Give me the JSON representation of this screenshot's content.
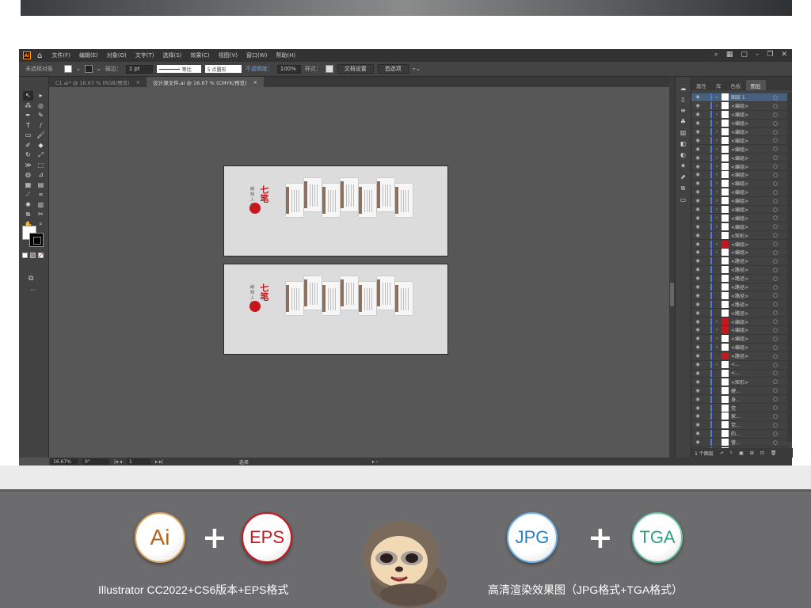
{
  "menubar": {
    "logo": "Ai",
    "items": [
      "文件(F)",
      "编辑(E)",
      "对象(O)",
      "文字(T)",
      "选择(S)",
      "效果(C)",
      "视图(V)",
      "窗口(W)",
      "帮助(H)"
    ]
  },
  "control": {
    "selection": "未选择对象",
    "stroke_label": "描边：",
    "stroke_value": "1 pt",
    "stroke_style": "等比",
    "brush": "5 点圆形",
    "opacity_label": "不透明度：",
    "opacity_value": "100%",
    "style_label": "样式：",
    "doc_setup": "文档设置",
    "preferences": "首选项"
  },
  "tabs": [
    {
      "label": "C1.ai* @ 16.67 % (RGB/预览)"
    },
    {
      "label": "设计源文件.ai @ 16.67 % (CMYK/预览)"
    }
  ],
  "close_glyph": "×",
  "artboard": {
    "title_red": "七笔",
    "title_red2": "悦",
    "subtitle": "翩翔人生"
  },
  "layers_panel": {
    "tabs": [
      "属性",
      "库",
      "色板",
      "图层"
    ],
    "layer_name": "图层 1",
    "rows": [
      {
        "label": "<编组>",
        "exp": true
      },
      {
        "label": "<编组>",
        "exp": true
      },
      {
        "label": "<编组>",
        "exp": true
      },
      {
        "label": "<编组>",
        "exp": true
      },
      {
        "label": "<编组>",
        "exp": true
      },
      {
        "label": "<编组>",
        "exp": true
      },
      {
        "label": "<编组>",
        "exp": true
      },
      {
        "label": "<编组>",
        "exp": true
      },
      {
        "label": "<编组>",
        "exp": true
      },
      {
        "label": "<编组>",
        "exp": true
      },
      {
        "label": "<编组>",
        "exp": true
      },
      {
        "label": "<编组>",
        "exp": true
      },
      {
        "label": "<编组>",
        "exp": true
      },
      {
        "label": "<编组>",
        "exp": true
      },
      {
        "label": "<编组>",
        "exp": true
      },
      {
        "label": "<矩形>"
      },
      {
        "label": "<编组>",
        "exp": true,
        "red": true
      },
      {
        "label": "<编组>",
        "exp": true
      },
      {
        "label": "<路径>"
      },
      {
        "label": "<路径>"
      },
      {
        "label": "<路径>"
      },
      {
        "label": "<路径>"
      },
      {
        "label": "<路径>"
      },
      {
        "label": "<路径>"
      },
      {
        "label": "<路径>"
      },
      {
        "label": "<编组>",
        "exp": true,
        "red": true
      },
      {
        "label": "<编组>",
        "exp": true,
        "red": true
      },
      {
        "label": "<编组>",
        "exp": true
      },
      {
        "label": "<编组>",
        "exp": true
      },
      {
        "label": "<路径>",
        "red": true
      },
      {
        "label": "<...",
        "exp": true
      },
      {
        "label": "<..."
      },
      {
        "label": "<矩形>"
      },
      {
        "label": "健..."
      },
      {
        "label": "身..."
      },
      {
        "label": "党"
      },
      {
        "label": "家..."
      },
      {
        "label": "党..."
      },
      {
        "label": "的..."
      },
      {
        "label": "营..."
      },
      {
        "label": "人"
      },
      {
        "label": "固..."
      }
    ],
    "footer": "1 个图层"
  },
  "status": {
    "zoom": "16.67%",
    "rotate": "0°",
    "page": "1",
    "tool": "选择"
  },
  "banner": {
    "badges": [
      {
        "label": "Ai",
        "color": "#b5651d"
      },
      {
        "label": "EPS",
        "color": "#c8161d"
      },
      {
        "label": "JPG",
        "color": "#2a7fc1"
      },
      {
        "label": "TGA",
        "color": "#2f9e7c"
      }
    ],
    "plus": "+",
    "caption_left": "Illustrator CC2022+CS6版本+EPS格式",
    "caption_right": "高清渲染效果图（JPG格式+TGA格式）"
  }
}
